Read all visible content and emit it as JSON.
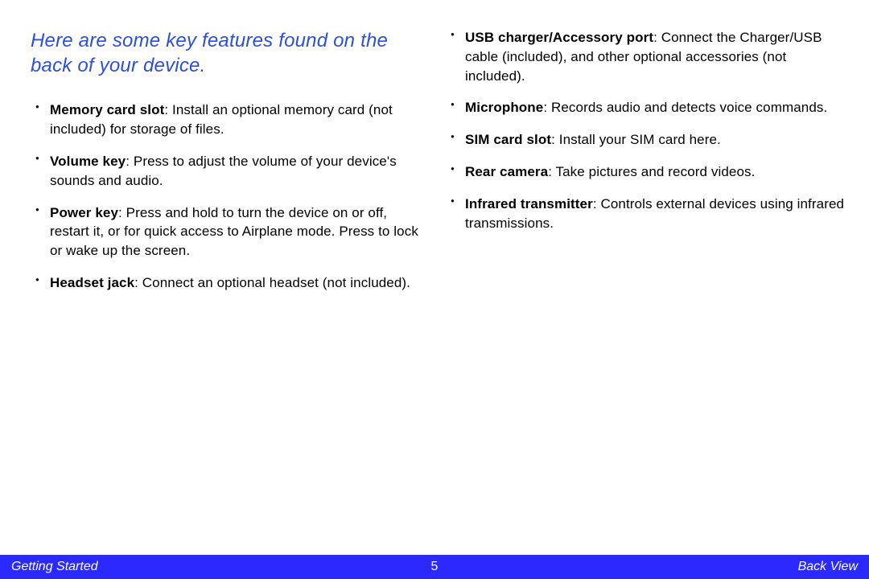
{
  "intro": "Here are some key features found on the back of your device.",
  "col1": [
    {
      "term": "Memory card slot",
      "desc": ": Install an optional memory card (not included) for storage of files."
    },
    {
      "term": "Volume key",
      "desc": ": Press to adjust the volume of your device's sounds and audio."
    },
    {
      "term": "Power key",
      "desc": ": Press and hold to turn the device on or off, restart it, or for quick access to Airplane mode. Press to lock or wake up the screen."
    },
    {
      "term": "Headset jack",
      "desc": ": Connect an optional headset (not included)."
    }
  ],
  "col2": [
    {
      "term": "USB charger/Accessory port",
      "desc": ": Connect the Charger/USB cable (included), and other optional accessories (not included)."
    },
    {
      "term": "Microphone",
      "desc": ": Records audio and detects voice commands."
    },
    {
      "term": "SIM card slot",
      "desc": ": Install your SIM card here."
    },
    {
      "term": "Rear camera",
      "desc": ": Take pictures and record videos."
    },
    {
      "term": "Infrared transmitter",
      "desc": ": Controls external devices using infrared transmissions."
    }
  ],
  "footer": {
    "left": "Getting Started",
    "page": "5",
    "right": "Back View"
  }
}
